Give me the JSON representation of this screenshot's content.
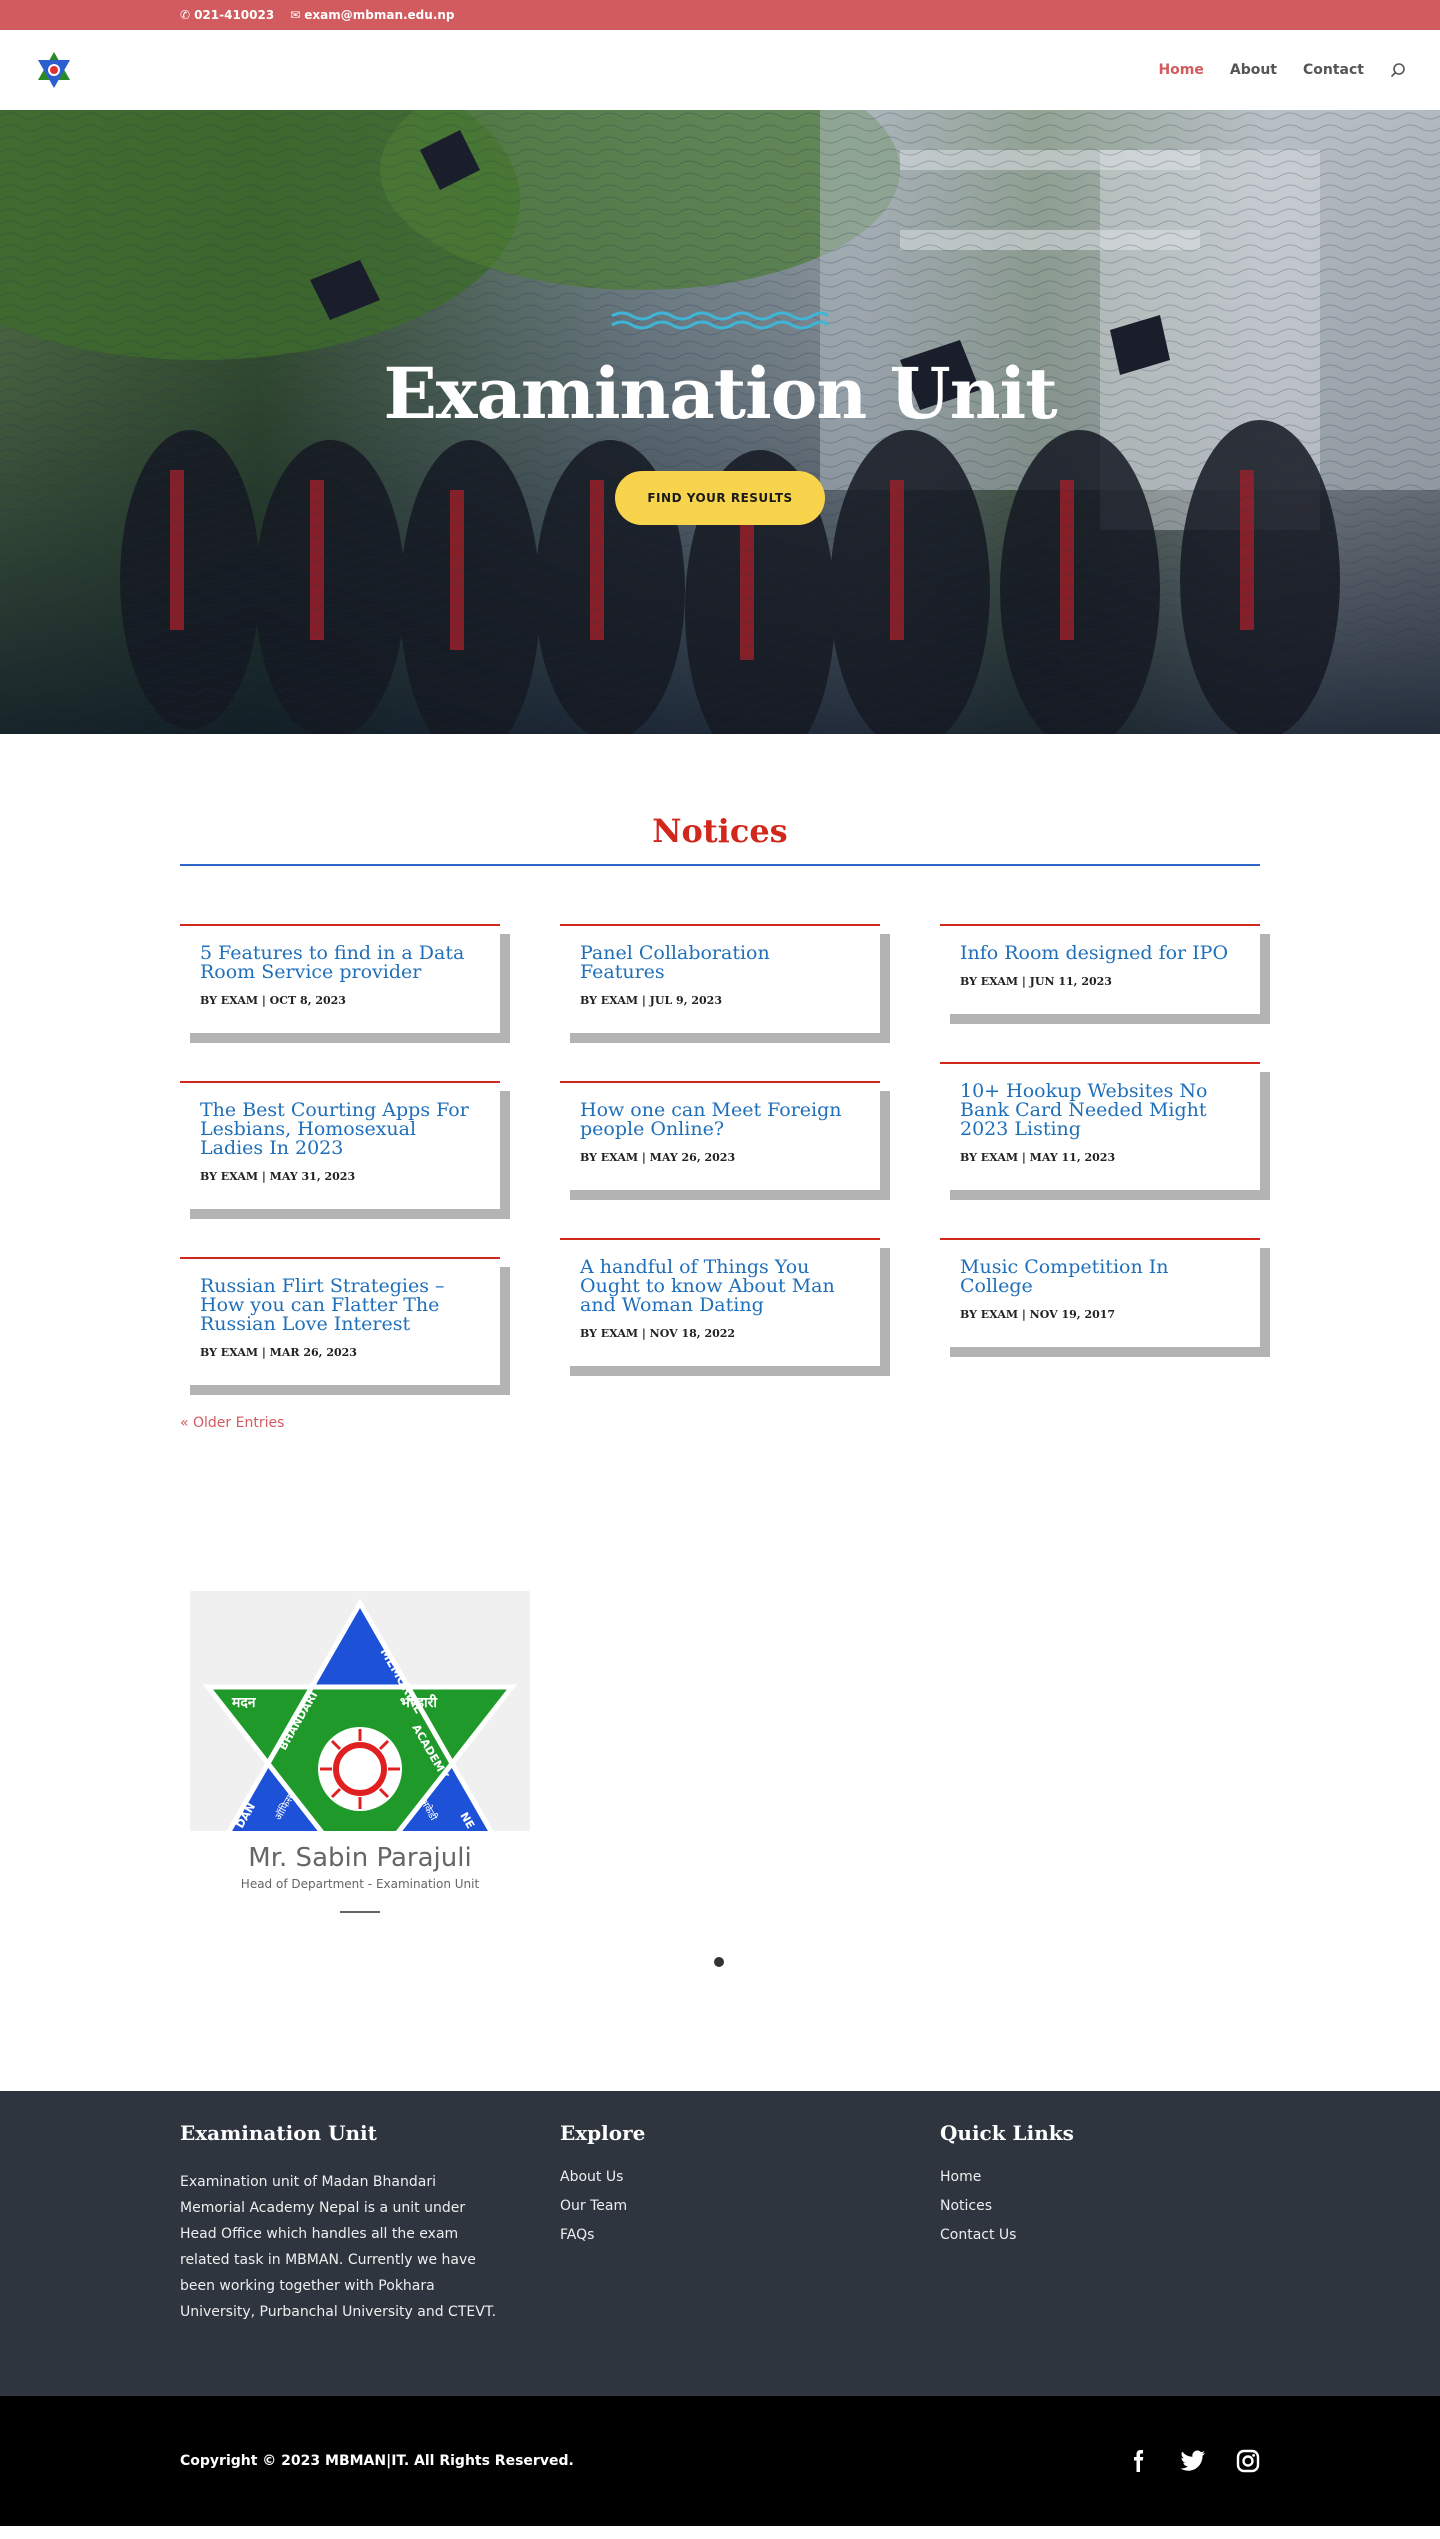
{
  "topbar": {
    "phone": "021-410023",
    "email": "exam@mbman.edu.np"
  },
  "nav": {
    "items": [
      {
        "label": "Home",
        "active": true
      },
      {
        "label": "About"
      },
      {
        "label": "Contact"
      }
    ]
  },
  "hero": {
    "title": "Examination Unit",
    "button": "FIND YOUR RESULTS"
  },
  "notices": {
    "title": "Notices",
    "columns": [
      [
        {
          "title": "5 Features to find in a Data Room Service provider",
          "meta": "BY EXAM | OCT 8, 2023"
        },
        {
          "title": "The Best Courting Apps For Lesbians, Homosexual Ladies In 2023",
          "meta": "BY EXAM | MAY 31, 2023"
        },
        {
          "title": "Russian Flirt Strategies – How you can Flatter The Russian Love Interest",
          "meta": "BY EXAM | MAR 26, 2023"
        }
      ],
      [
        {
          "title": "Panel Collaboration Features",
          "meta": "BY EXAM | JUL 9, 2023"
        },
        {
          "title": "How one can Meet Foreign people Online?",
          "meta": "BY EXAM | MAY 26, 2023"
        },
        {
          "title": "A handful of Things You Ought to know About Man and Woman Dating",
          "meta": "BY EXAM | NOV 18, 2022"
        }
      ],
      [
        {
          "title": "Info Room designed for IPO",
          "meta": "BY EXAM | JUN 11, 2023"
        },
        {
          "title": "10+ Hookup Websites No Bank Card Needed Might 2023 Listing",
          "meta": "BY EXAM | MAY 11, 2023"
        },
        {
          "title": "Music Competition In College",
          "meta": "BY EXAM | NOV 19, 2017"
        }
      ]
    ],
    "older": "« Older Entries"
  },
  "team": {
    "name": "Mr. Sabin Parajuli",
    "role": "Head of Department - Examination Unit",
    "logo_text": {
      "top": "MEMORIAL",
      "left": "मदन",
      "right": "भण्डारी",
      "mid_left": "BHANDARI",
      "mid_right": "ACADEMY",
      "bottom_left": "DAN",
      "bottom_right": "NE",
      "small_left": "ऑफिस",
      "small_right": "अकेडी"
    }
  },
  "footer": {
    "col1": {
      "title": "Examination Unit",
      "text": "Examination unit of Madan Bhandari Memorial Academy Nepal is a unit under Head Office which handles all the exam related task in MBMAN. Currently we have been working together with Pokhara University, Purbanchal University and CTEVT."
    },
    "col2": {
      "title": "Explore",
      "links": [
        "About Us",
        "Our Team",
        "FAQs"
      ]
    },
    "col3": {
      "title": "Quick Links",
      "links": [
        "Home",
        "Notices",
        "Contact Us"
      ]
    },
    "copyright": "Copyright © 2023 MBMAN|IT. All Rights Reserved."
  },
  "icons": [
    "phone-icon",
    "email-icon",
    "search-icon",
    "facebook-icon",
    "twitter-icon",
    "instagram-icon"
  ]
}
